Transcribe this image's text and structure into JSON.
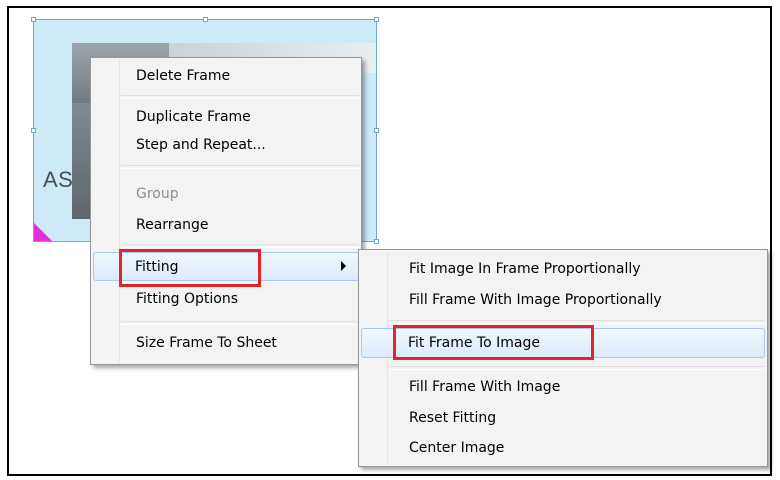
{
  "canvas": {
    "frame_text": "AS"
  },
  "context_menu": {
    "items": [
      {
        "label": "Delete Frame"
      },
      {
        "label": "Duplicate Frame"
      },
      {
        "label": "Step and Repeat..."
      },
      {
        "label": "Group",
        "disabled": true
      },
      {
        "label": "Rearrange"
      },
      {
        "label": "Fitting",
        "has_submenu": true,
        "highlighted": true
      },
      {
        "label": "Fitting Options"
      },
      {
        "label": "Size Frame To Sheet"
      }
    ]
  },
  "submenu": {
    "items": [
      {
        "label": "Fit Image In Frame Proportionally"
      },
      {
        "label": "Fill Frame With Image Proportionally"
      },
      {
        "label": "Fit Frame To Image",
        "highlighted": true
      },
      {
        "label": "Fill Frame With Image"
      },
      {
        "label": "Reset Fitting"
      },
      {
        "label": "Center Image"
      }
    ]
  },
  "annotations": {
    "highlight_color": "#e8212b",
    "boxed_items": [
      "Fitting",
      "Fit Frame To Image"
    ]
  }
}
